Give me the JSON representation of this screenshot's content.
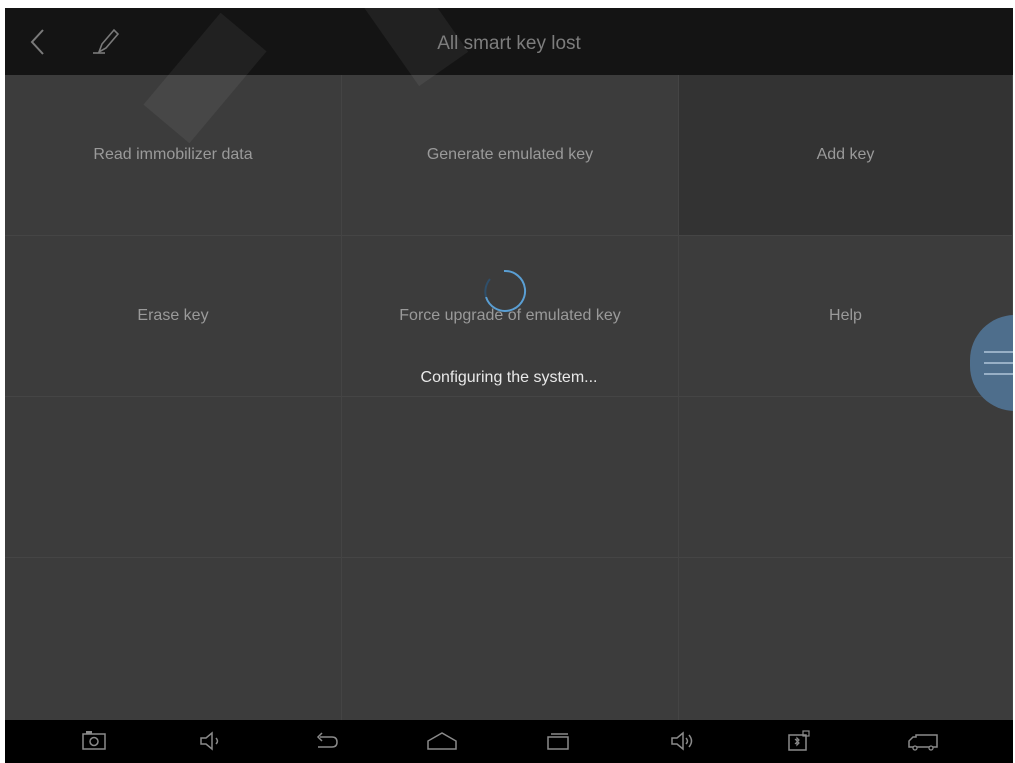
{
  "header": {
    "title": "All smart key lost",
    "back_icon": "chevron-left-icon",
    "edit_icon": "pencil-icon"
  },
  "grid": {
    "cells": [
      {
        "label": "Read immobilizer data"
      },
      {
        "label": "Generate emulated key"
      },
      {
        "label": "Add key"
      },
      {
        "label": "Erase key"
      },
      {
        "label": "Force upgrade of emulated key"
      },
      {
        "label": "Help"
      }
    ]
  },
  "loading": {
    "message": "Configuring the system...",
    "spinner_color": "#5a9fd4"
  },
  "floating_button": {
    "icon": "menu-icon",
    "color": "#4e6e8c"
  },
  "navbar": {
    "icons": [
      "screenshot-icon",
      "volume-down-icon",
      "back-arrow-icon",
      "home-icon",
      "recent-apps-icon",
      "volume-up-icon",
      "vci-connect-icon",
      "truck-icon"
    ]
  },
  "colors": {
    "header_bg": "#141414",
    "grid_bg": "#3c3c3c",
    "navbar_bg": "#000000",
    "text_dim": "#9a9a9a"
  }
}
